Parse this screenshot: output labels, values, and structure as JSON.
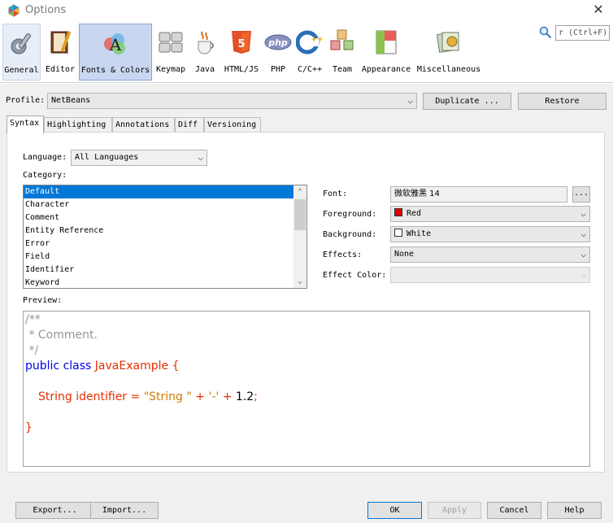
{
  "window": {
    "title": "Options",
    "close_glyph": "✕"
  },
  "search": {
    "value": "r (Ctrl+F)"
  },
  "categories": [
    {
      "label": "General",
      "icon": "general-icon"
    },
    {
      "label": "Editor",
      "icon": "editor-icon"
    },
    {
      "label": "Fonts & Colors",
      "icon": "fonts-colors-icon",
      "selected": true
    },
    {
      "label": "Keymap",
      "icon": "keymap-icon"
    },
    {
      "label": "Java",
      "icon": "java-icon"
    },
    {
      "label": "HTML/JS",
      "icon": "html5-icon"
    },
    {
      "label": "PHP",
      "icon": "php-icon"
    },
    {
      "label": "C/C++",
      "icon": "cpp-icon"
    },
    {
      "label": "Team",
      "icon": "team-icon"
    },
    {
      "label": "Appearance",
      "icon": "appearance-icon"
    },
    {
      "label": "Miscellaneous",
      "icon": "miscellaneous-icon"
    }
  ],
  "profile": {
    "label": "Profile:",
    "value": "NetBeans",
    "duplicate": "Duplicate ...",
    "restore": "Restore"
  },
  "tabs": [
    "Syntax",
    "Highlighting",
    "Annotations",
    "Diff",
    "Versioning"
  ],
  "syntax": {
    "language_label": "Language:",
    "language_value": "All Languages",
    "category_label": "Category:",
    "categories": [
      "Default",
      "Character",
      "Comment",
      "Entity Reference",
      "Error",
      "Field",
      "Identifier",
      "Keyword"
    ],
    "selected_category": "Default",
    "font_label": "Font:",
    "font_value": "微软雅黑 14",
    "font_button": "...",
    "foreground_label": "Foreground:",
    "foreground_value": "Red",
    "foreground_color": "#e00000",
    "background_label": "Background:",
    "background_value": "White",
    "background_color": "#ffffff",
    "effects_label": "Effects:",
    "effects_value": "None",
    "effect_color_label": "Effect Color:",
    "preview_label": "Preview:"
  },
  "preview_code": {
    "line1": "/**",
    "line2": " * Comment.",
    "line3": " */",
    "kw_public": "public",
    "kw_class": "class",
    "class_name": "JavaExample",
    "brace_open": "{",
    "type": "String",
    "identifier": "identifier",
    "eq": "=",
    "str1": "\"String \"",
    "plus1": "+",
    "str2": "'-'",
    "plus2": "+",
    "num": "1.2",
    "semi": ";",
    "brace_close": "}"
  },
  "footer": {
    "export": "Export...",
    "import": "Import...",
    "ok": "OK",
    "apply": "Apply",
    "cancel": "Cancel",
    "help": "Help"
  }
}
